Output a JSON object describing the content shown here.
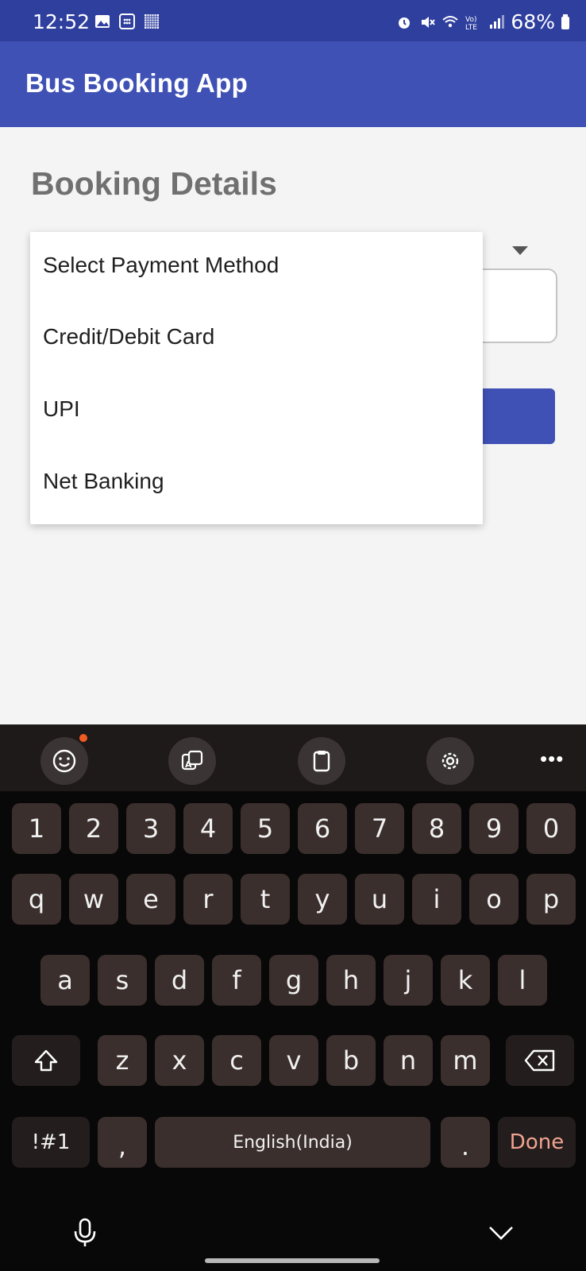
{
  "status_bar": {
    "time": "12:52",
    "battery": "68%"
  },
  "app_bar": {
    "title": "Bus Booking App"
  },
  "page": {
    "heading": "Booking Details"
  },
  "payment_dropdown": {
    "options": [
      "Select Payment Method",
      "Credit/Debit Card",
      "UPI",
      "Net Banking"
    ]
  },
  "keyboard": {
    "row_numbers": [
      "1",
      "2",
      "3",
      "4",
      "5",
      "6",
      "7",
      "8",
      "9",
      "0"
    ],
    "row_q": [
      "q",
      "w",
      "e",
      "r",
      "t",
      "y",
      "u",
      "i",
      "o",
      "p"
    ],
    "row_a": [
      "a",
      "s",
      "d",
      "f",
      "g",
      "h",
      "j",
      "k",
      "l"
    ],
    "row_z": [
      "z",
      "x",
      "c",
      "v",
      "b",
      "n",
      "m"
    ],
    "symbols_label": "!#1",
    "comma_label": ",",
    "space_label": "English(India)",
    "period_label": ".",
    "done_label": "Done",
    "accent_color": "#f3a391"
  }
}
